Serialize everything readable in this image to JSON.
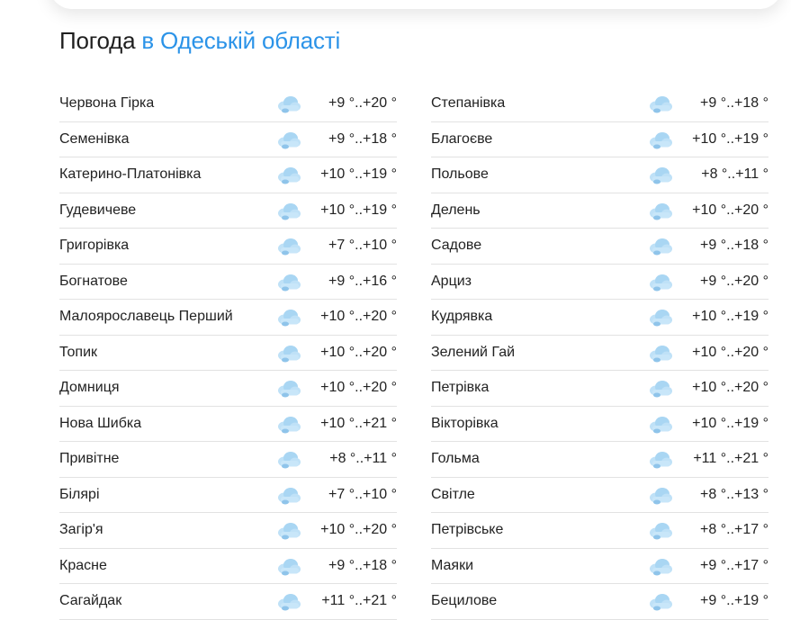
{
  "title": {
    "prefix": "Погода",
    "region": "в Одеській області"
  },
  "colors": {
    "accent": "#2b93e8",
    "cloud": "#bfe1f7",
    "cloud_dark": "#9fcdee"
  },
  "icons": {
    "weather": "cloudy-icon"
  },
  "left": [
    {
      "name": "Червона Гірка",
      "temp": "+9 °..+20 °"
    },
    {
      "name": "Семенівка",
      "temp": "+9 °..+18 °"
    },
    {
      "name": "Катерино-Платонівка",
      "temp": "+10 °..+19 °"
    },
    {
      "name": "Гудевичеве",
      "temp": "+10 °..+19 °"
    },
    {
      "name": "Григорівка",
      "temp": "+7 °..+10 °"
    },
    {
      "name": "Богнатове",
      "temp": "+9 °..+16 °"
    },
    {
      "name": "Малоярославець Перший",
      "temp": "+10 °..+20 °"
    },
    {
      "name": "Топик",
      "temp": "+10 °..+20 °"
    },
    {
      "name": "Домниця",
      "temp": "+10 °..+20 °"
    },
    {
      "name": "Нова Шибка",
      "temp": "+10 °..+21 °"
    },
    {
      "name": "Привітне",
      "temp": "+8 °..+11 °"
    },
    {
      "name": "Білярі",
      "temp": "+7 °..+10 °"
    },
    {
      "name": "Загір'я",
      "temp": "+10 °..+20 °"
    },
    {
      "name": "Красне",
      "temp": "+9 °..+18 °"
    },
    {
      "name": "Сагайдак",
      "temp": "+11 °..+21 °"
    }
  ],
  "right": [
    {
      "name": "Степанівка",
      "temp": "+9 °..+18 °"
    },
    {
      "name": "Благоєве",
      "temp": "+10 °..+19 °"
    },
    {
      "name": "Польове",
      "temp": "+8 °..+11 °"
    },
    {
      "name": "Делень",
      "temp": "+10 °..+20 °"
    },
    {
      "name": "Садове",
      "temp": "+9 °..+18 °"
    },
    {
      "name": "Арциз",
      "temp": "+9 °..+20 °"
    },
    {
      "name": "Кудрявка",
      "temp": "+10 °..+19 °"
    },
    {
      "name": "Зелений Гай",
      "temp": "+10 °..+20 °"
    },
    {
      "name": "Петрівка",
      "temp": "+10 °..+20 °"
    },
    {
      "name": "Вікторівка",
      "temp": "+10 °..+19 °"
    },
    {
      "name": "Гольма",
      "temp": "+11 °..+21 °"
    },
    {
      "name": "Світле",
      "temp": "+8 °..+13 °"
    },
    {
      "name": "Петрівське",
      "temp": "+8 °..+17 °"
    },
    {
      "name": "Маяки",
      "temp": "+9 °..+17 °"
    },
    {
      "name": "Бецилове",
      "temp": "+9 °..+19 °"
    }
  ]
}
